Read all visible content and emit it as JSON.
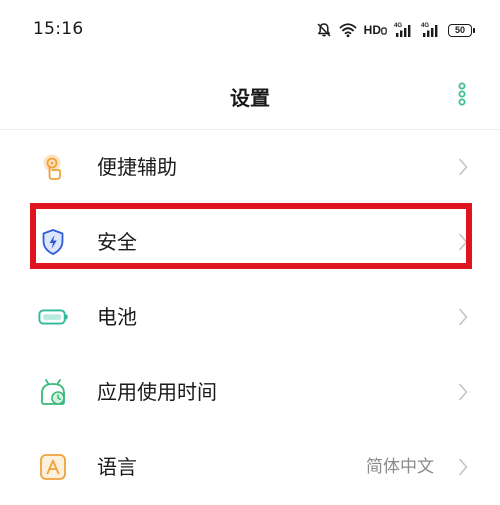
{
  "status_bar": {
    "time": "15:16",
    "network_label": "HD",
    "battery_level": "50"
  },
  "header": {
    "title": "设置"
  },
  "settings": {
    "items": [
      {
        "label": "便捷辅助",
        "icon": "touch-assist-icon",
        "value": ""
      },
      {
        "label": "安全",
        "icon": "shield-bolt-icon",
        "value": ""
      },
      {
        "label": "电池",
        "icon": "battery-icon",
        "value": ""
      },
      {
        "label": "应用使用时间",
        "icon": "app-usage-clock-icon",
        "value": ""
      },
      {
        "label": "语言",
        "icon": "language-a-icon",
        "value": "简体中文"
      }
    ]
  },
  "colors": {
    "accent_green": "#3cc08c",
    "assist_orange": "#f0a13a",
    "shield_blue": "#2f5bd6",
    "battery_teal": "#2fb89a",
    "highlight_red": "#e0141e",
    "chevron_gray": "#c4c4c4"
  }
}
